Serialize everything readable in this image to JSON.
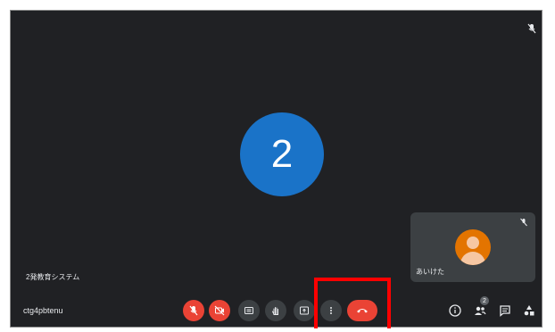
{
  "stage": {
    "participant_count_label": "2"
  },
  "self_tile": {
    "name": "あいけた"
  },
  "caption": {
    "text": "2発教育システム"
  },
  "meeting": {
    "code": "ctg4pbtenu"
  },
  "controls": [
    {
      "name": "mic-muted-button",
      "icon": "mic-off-icon",
      "state": "off"
    },
    {
      "name": "camera-off-button",
      "icon": "camera-off-icon",
      "state": "off"
    },
    {
      "name": "captions-button",
      "icon": "captions-icon"
    },
    {
      "name": "raise-hand-button",
      "icon": "hand-icon"
    },
    {
      "name": "present-button",
      "icon": "present-icon"
    },
    {
      "name": "more-options-button",
      "icon": "more-vert-icon"
    },
    {
      "name": "leave-call-button",
      "icon": "call-end-icon"
    }
  ],
  "right_controls": {
    "info_icon": "info-icon",
    "people_icon": "people-icon",
    "people_count": "2",
    "chat_icon": "chat-icon",
    "activities_icon": "activities-icon"
  },
  "colors": {
    "background": "#202124",
    "main_avatar": "#1a73c8",
    "danger": "#ea4335",
    "highlight": "#ff0000",
    "tile": "#3c4043",
    "self_avatar": "#e37400"
  }
}
